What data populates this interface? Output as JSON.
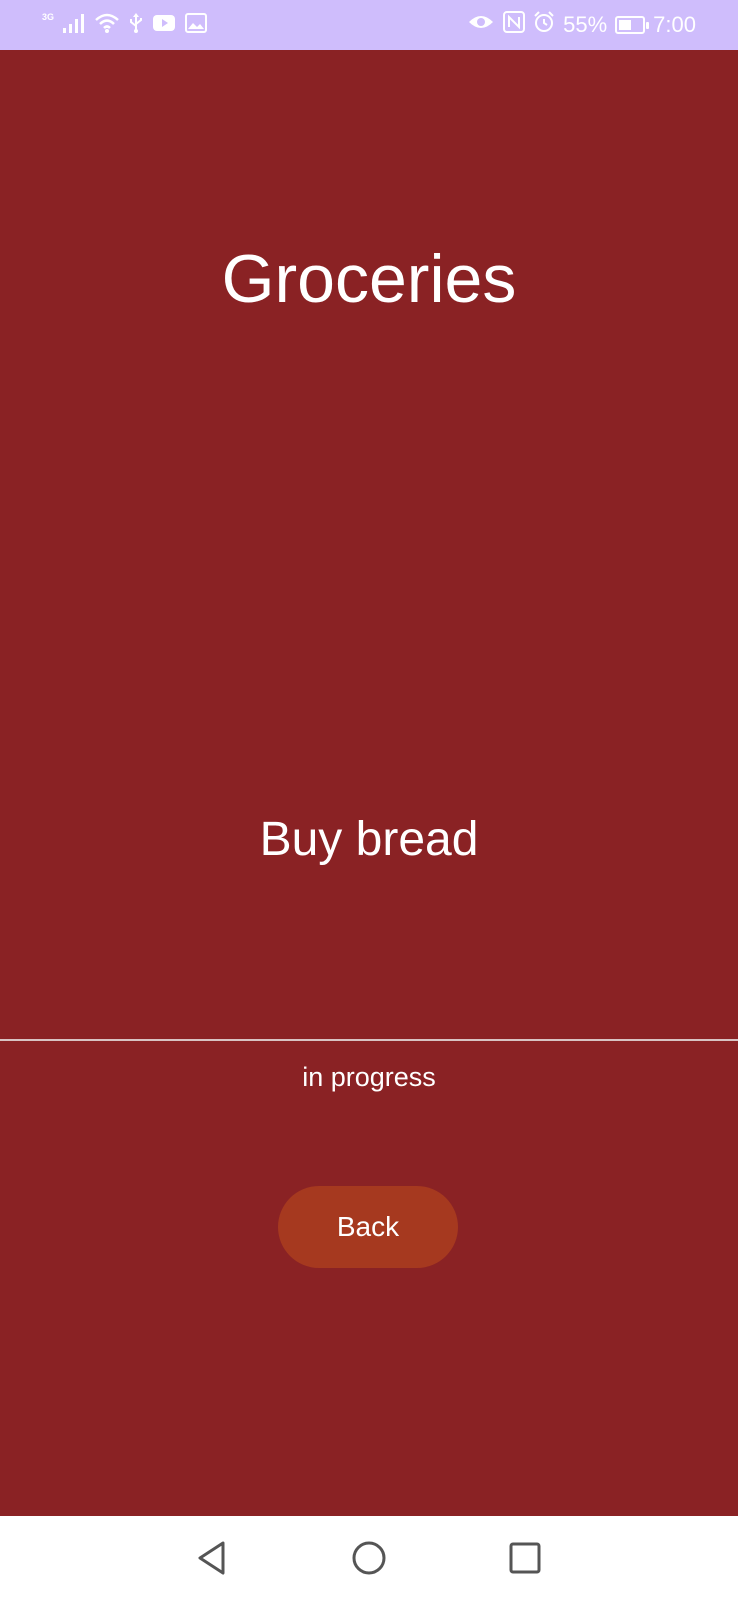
{
  "status_bar": {
    "network_type": "3G",
    "battery_percent": "55%",
    "battery_level": 0.55,
    "time": "7:00",
    "icons": [
      "signal-icon",
      "wifi-icon",
      "usb-icon",
      "youtube-icon",
      "gallery-icon",
      "eye-icon",
      "nfc-icon",
      "alarm-icon",
      "battery-charging-icon"
    ],
    "background_color": "#cfbdfc"
  },
  "main": {
    "title": "Groceries",
    "task": "Buy bread",
    "status": "in progress",
    "back_label": "Back",
    "background_color": "#8a2224",
    "button_color": "#a6391f"
  },
  "nav_bar": {
    "icons": [
      "back-triangle-icon",
      "home-circle-icon",
      "recents-square-icon"
    ]
  }
}
